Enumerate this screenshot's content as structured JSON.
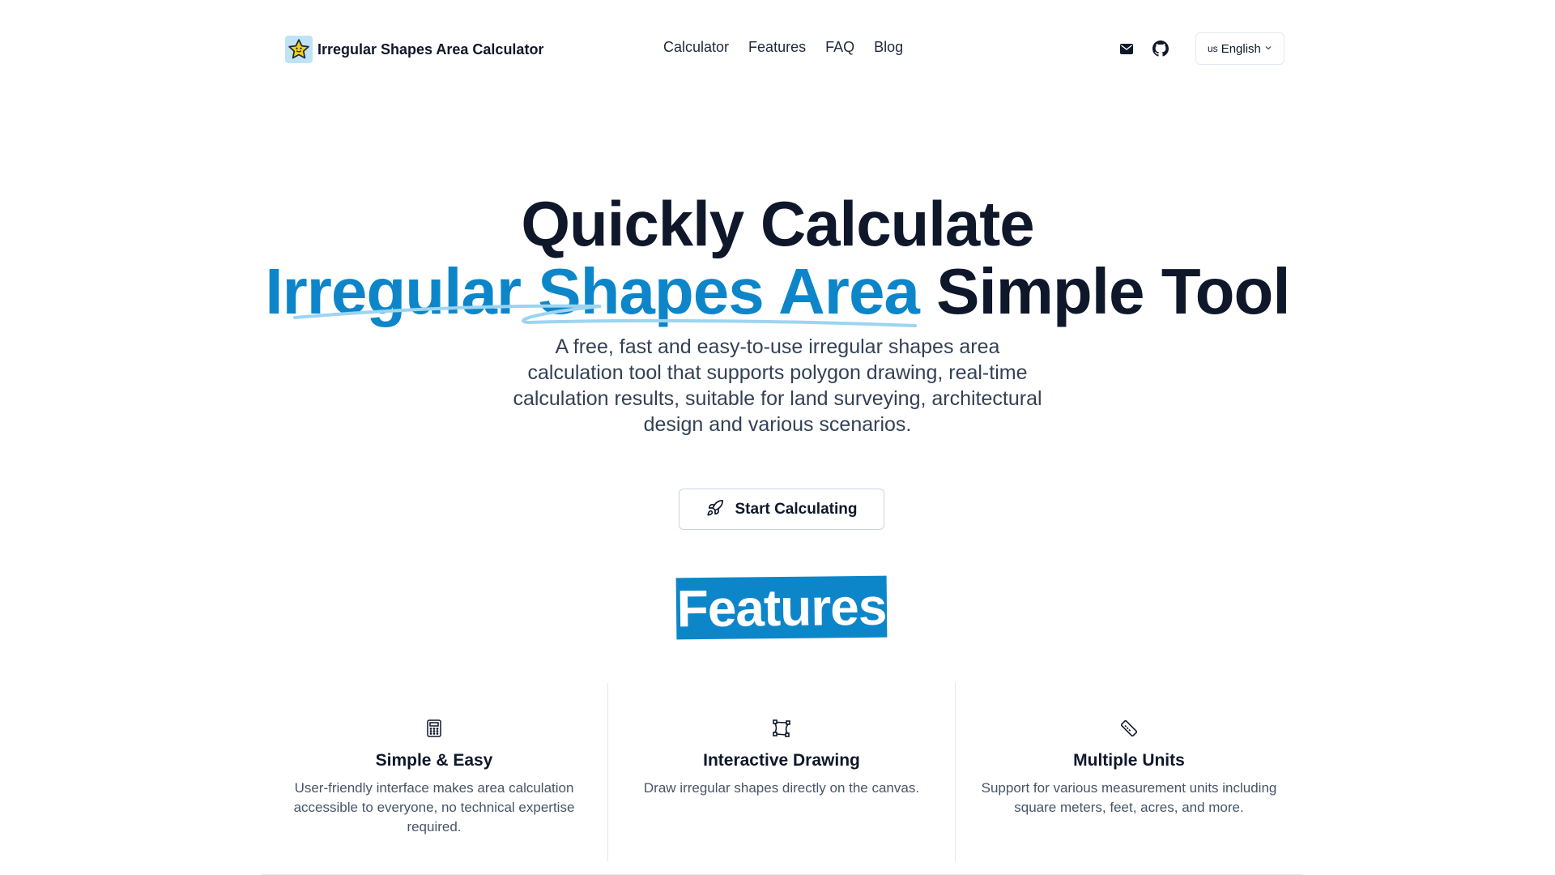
{
  "header": {
    "brand_name": "Irregular Shapes Area Calculator",
    "brand_logo_icon": "star-icon",
    "nav": [
      {
        "label": "Calculator"
      },
      {
        "label": "Features"
      },
      {
        "label": "FAQ"
      },
      {
        "label": "Blog"
      }
    ],
    "actions": {
      "mail_icon": "mail-icon",
      "github_icon": "github-icon",
      "language": {
        "flag": "us",
        "label": "English"
      }
    }
  },
  "hero": {
    "line1": "Quickly Calculate",
    "line2_accent": "Irregular Shapes Area",
    "line2_rest": "Simple Tool",
    "subtitle": "A free, fast and easy-to-use irregular shapes area calculation tool that supports polygon drawing, real-time calculation results, suitable for land surveying, architectural design and various scenarios.",
    "cta_label": "Start Calculating",
    "cta_icon": "rocket-icon"
  },
  "features": {
    "title": "Features",
    "items": [
      {
        "icon": "calculator-icon",
        "title": "Simple & Easy",
        "description": "User-friendly interface makes area calculation accessible to everyone, no technical expertise required."
      },
      {
        "icon": "polygon-draw-icon",
        "title": "Interactive Drawing",
        "description": "Draw irregular shapes directly on the canvas."
      },
      {
        "icon": "ruler-icon",
        "title": "Multiple Units",
        "description": "Support for various measurement units including square meters, feet, acres, and more."
      }
    ]
  },
  "colors": {
    "accent": "#0d86c9",
    "text": "#0f172a",
    "muted": "#475569"
  }
}
